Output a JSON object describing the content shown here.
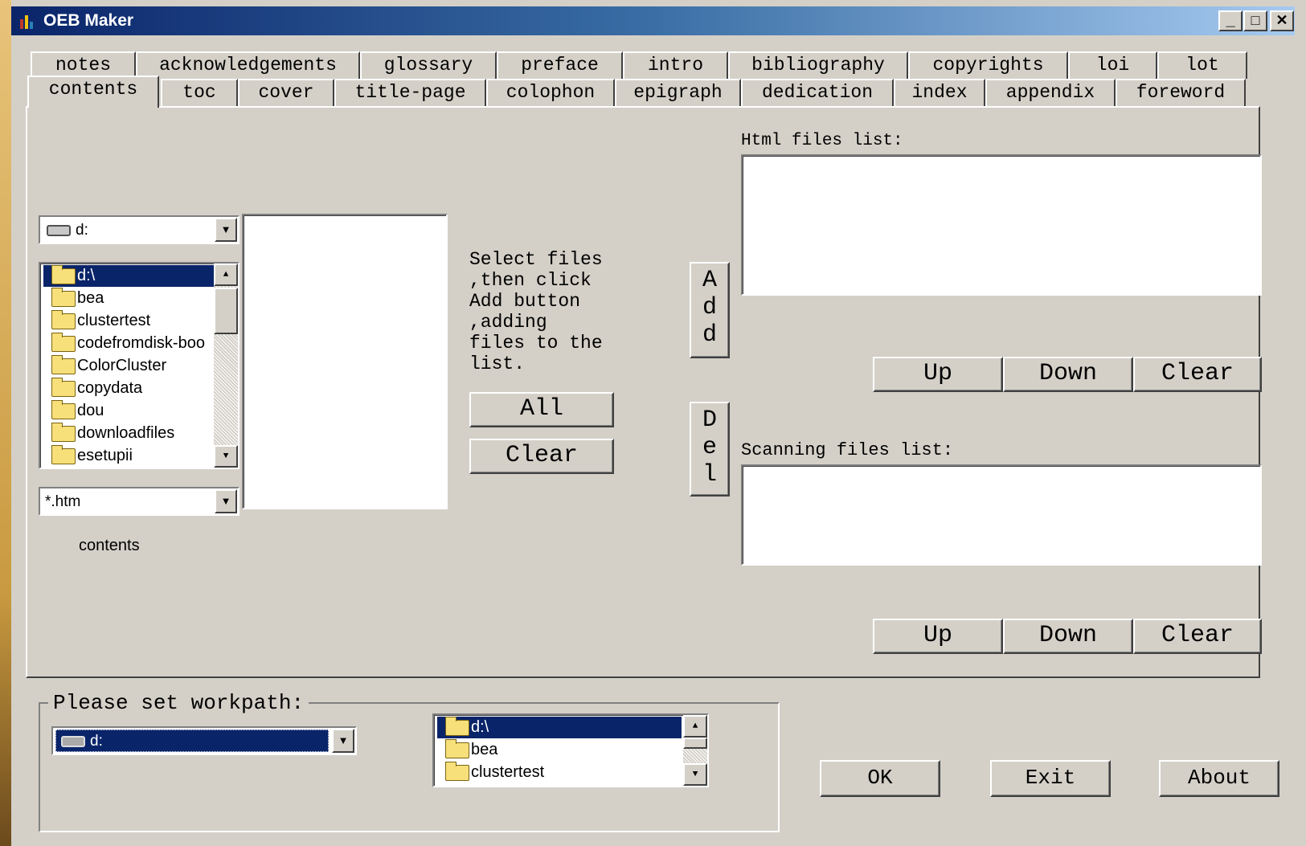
{
  "window": {
    "title": "OEB Maker",
    "min": "_",
    "max": "□",
    "close": "✕"
  },
  "tabs_row1": [
    "notes",
    "acknowledgements",
    "glossary",
    "preface",
    "intro",
    "bibliography",
    "copyrights",
    "loi",
    "lot"
  ],
  "tabs_row2": [
    "contents",
    "toc",
    "cover",
    "title-page",
    "colophon",
    "epigraph",
    "dedication",
    "index",
    "appendix",
    "foreword"
  ],
  "drive_combo": {
    "value": "d:"
  },
  "dir_list": [
    "d:\\",
    "bea",
    "clustertest",
    "codefromdisk-boo",
    "ColorCluster",
    "copydata",
    "dou",
    "downloadfiles",
    "esetupii"
  ],
  "filter_combo": {
    "value": "*.htm"
  },
  "section_label": "contents",
  "instructions": [
    "Select files",
    ",then click",
    "Add button",
    ",adding",
    "files to the",
    "list."
  ],
  "all_button": "All",
  "clear_button": "Clear",
  "add_button": [
    "A",
    "d",
    "d"
  ],
  "del_button": [
    "D",
    "e",
    "l"
  ],
  "html_list": {
    "label": "Html files list:",
    "up": "Up",
    "down": "Down",
    "clear": "Clear"
  },
  "scan_list": {
    "label": "Scanning files list:",
    "up": "Up",
    "down": "Down",
    "clear": "Clear"
  },
  "workpath": {
    "legend": "Please set workpath:",
    "drive": "d:",
    "dirs": [
      "d:\\",
      "bea",
      "clustertest"
    ]
  },
  "ok_button": "OK",
  "exit_button": "Exit",
  "about_button": "About",
  "colors": {
    "titlebar": "#0a246a",
    "selection": "#0a246a",
    "face": "#d4d0c8"
  }
}
